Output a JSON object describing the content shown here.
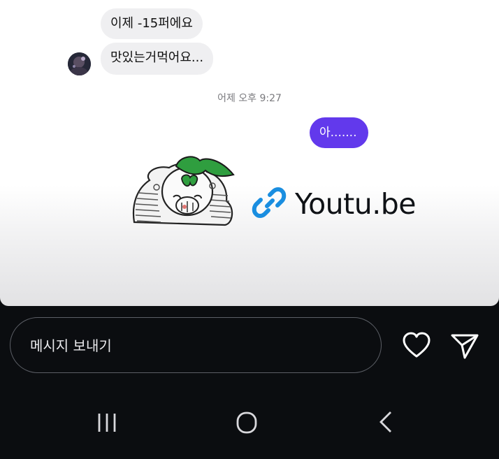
{
  "conversation": {
    "received_messages": [
      "이제 -15퍼에요",
      "맛있는거먹어요..."
    ],
    "timestamp": "어제 오후 9:27",
    "sent_message": "아.......",
    "link_preview": {
      "domain": "Youtu.be",
      "icon": "link-icon"
    }
  },
  "composer": {
    "placeholder": "메시지 보내기"
  },
  "actions": {
    "like_icon": "heart-icon",
    "send_icon": "send-icon"
  },
  "navigation": {
    "recents_icon": "recents-icon",
    "home_icon": "home-icon",
    "back_icon": "back-icon"
  },
  "colors": {
    "sent_bubble": "#6239ec",
    "received_bubble": "#efeff1",
    "composer_bg": "#0b0d10",
    "link_blue": "#1a8ee0"
  }
}
